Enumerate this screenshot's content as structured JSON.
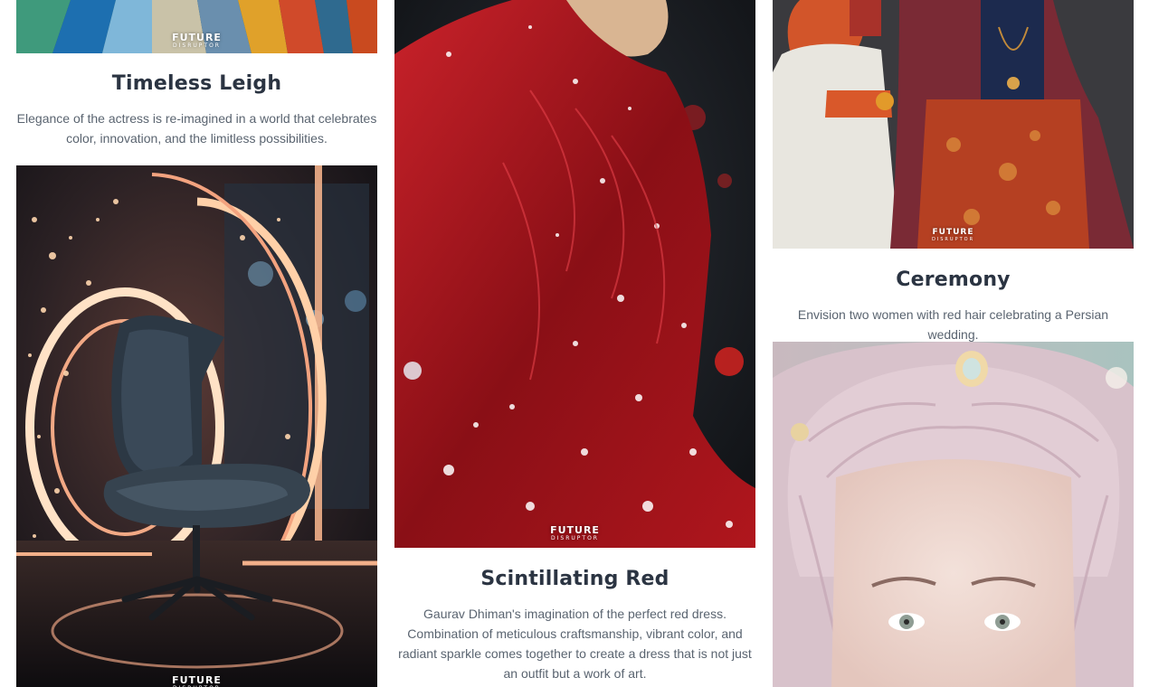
{
  "gallery": {
    "watermark": {
      "line1": "FUTURE",
      "line2": "DISRUPTOR"
    },
    "cards": [
      {
        "title": "Timeless Leigh",
        "description": "Elegance of the actress is re-imagined in a world that celebrates color, innovation, and the limitless possibilities."
      },
      {
        "title": "Scintillating Red",
        "description": "Gaurav Dhiman's imagination of the perfect red dress. Combination of meticulous craftsmanship, vibrant color, and radiant sparkle comes together to create a dress that is not just an outfit but a work of art."
      },
      {
        "title": "Ceremony",
        "description": "Envision two women with red hair celebrating a Persian wedding."
      }
    ]
  }
}
